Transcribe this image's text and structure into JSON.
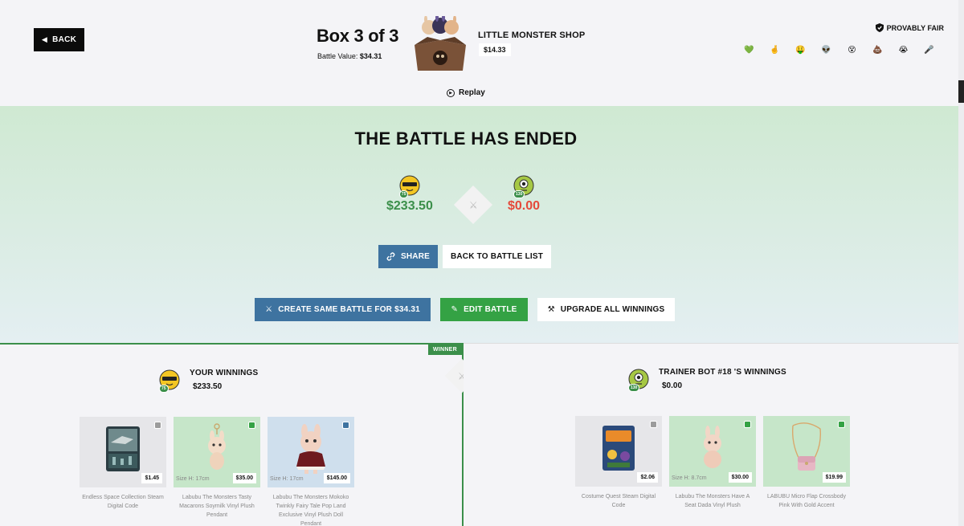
{
  "header": {
    "back_label": "BACK",
    "box_title": "Box 3 of 3",
    "battle_value_label": "Battle Value:",
    "battle_value": "$34.31",
    "shop_name": "LITTLE MONSTER SHOP",
    "shop_price": "$14.33",
    "provably_fair": "PROVABLY FAIR",
    "replay": "Replay",
    "emojis": [
      "💚",
      "🤞",
      "🤑",
      "👽",
      "😵",
      "💩",
      "😭",
      "🎤"
    ]
  },
  "result": {
    "title": "THE BATTLE HAS ENDED",
    "players": [
      {
        "amount": "$233.50",
        "level": "75"
      },
      {
        "amount": "$0.00",
        "level": "130"
      }
    ],
    "buttons": {
      "share": "SHARE",
      "back_to_list": "BACK TO BATTLE LIST",
      "create_same": "CREATE SAME BATTLE FOR $34.31",
      "edit": "EDIT BATTLE",
      "upgrade": "UPGRADE ALL WINNINGS"
    }
  },
  "left_panel": {
    "winner_tag": "WINNER",
    "title": "YOUR WINNINGS",
    "amount": "$233.50",
    "level": "75",
    "items": [
      {
        "name": "Endless Space Collection Steam Digital Code",
        "price": "$1.45",
        "size": "",
        "rarity": "gray"
      },
      {
        "name": "Labubu The Monsters Tasty Macarons Soymilk Vinyl Plush Pendant",
        "price": "$35.00",
        "size": "Size H: 17cm",
        "rarity": "green"
      },
      {
        "name": "Labubu The Monsters Mokoko Twinkly Fairy Tale Pop Land Exclusive Vinyl Plush Doll Pendant",
        "price": "$145.00",
        "size": "Size H: 17cm",
        "rarity": "blue"
      }
    ]
  },
  "right_panel": {
    "title": "TRAINER BOT #18 'S WINNINGS",
    "amount": "$0.00",
    "level": "130",
    "items": [
      {
        "name": "Costume Quest Steam Digital Code",
        "price": "$2.06",
        "size": "",
        "rarity": "gray"
      },
      {
        "name": "Labubu The Monsters Have A Seat Dada Vinyl Plush",
        "price": "$30.00",
        "size": "Size H: 8.7cm",
        "rarity": "green"
      },
      {
        "name": "LABUBU Micro Flap Crossbody Pink With Gold Accent",
        "price": "$19.99",
        "size": "",
        "rarity": "green"
      }
    ]
  },
  "colors": {
    "win_green": "#3b8f4a",
    "lose_red": "#e5493a",
    "share_blue": "#3e73a0",
    "edit_green": "#34a244"
  }
}
